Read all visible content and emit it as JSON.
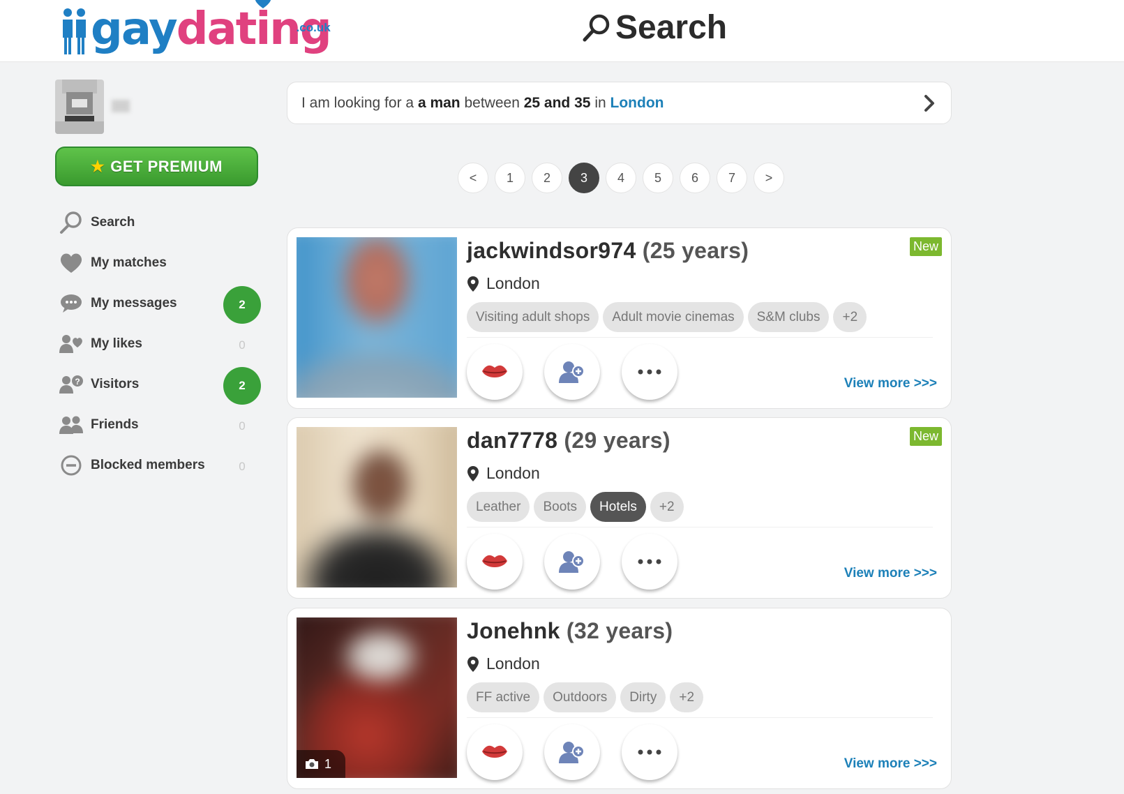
{
  "header": {
    "logo_part1": "gay",
    "logo_part2": "dating",
    "logo_tld": ".co.uk",
    "title": "Search"
  },
  "sidebar": {
    "premium_label": "GET PREMIUM",
    "items": [
      {
        "label": "Search",
        "icon": "search-icon",
        "count": ""
      },
      {
        "label": "My matches",
        "icon": "heart-icon",
        "count": ""
      },
      {
        "label": "My messages",
        "icon": "chat-icon",
        "count": "2"
      },
      {
        "label": "My likes",
        "icon": "likes-icon",
        "count": "0"
      },
      {
        "label": "Visitors",
        "icon": "visitors-icon",
        "count": "2"
      },
      {
        "label": "Friends",
        "icon": "friends-icon",
        "count": "0"
      },
      {
        "label": "Blocked members",
        "icon": "blocked-icon",
        "count": "0"
      }
    ]
  },
  "search": {
    "prefix": "I am looking for a",
    "subject": "a man",
    "between": "between",
    "range": "25 and 35",
    "in": "in",
    "location": "London"
  },
  "pagination": {
    "prev": "<",
    "pages": [
      "1",
      "2",
      "3",
      "4",
      "5",
      "6",
      "7"
    ],
    "current": "3",
    "next": ">"
  },
  "results": [
    {
      "username": "jackwindsor974",
      "age": "(25 years)",
      "badge": "New",
      "location": "London",
      "tags": [
        "Visiting adult shops",
        "Adult movie cinemas",
        "S&M clubs",
        "+2"
      ],
      "photo_count": "",
      "view_more": "View more >>>"
    },
    {
      "username": "dan7778",
      "age": "(29 years)",
      "badge": "New",
      "location": "London",
      "tags": [
        "Leather",
        "Boots",
        "Hotels",
        "+2"
      ],
      "photo_count": "",
      "view_more": "View more >>>"
    },
    {
      "username": "Jonehnk",
      "age": "(32 years)",
      "badge": "",
      "location": "London",
      "tags": [
        "FF active",
        "Outdoors",
        "Dirty",
        "+2"
      ],
      "photo_count": "1",
      "view_more": "View more >>>"
    }
  ],
  "colors": {
    "brand_blue": "#1f7fc4",
    "brand_pink": "#e0417f",
    "premium_green": "#3a9a2e",
    "badge_green": "#7cb82f",
    "link_blue": "#1c80b8"
  }
}
